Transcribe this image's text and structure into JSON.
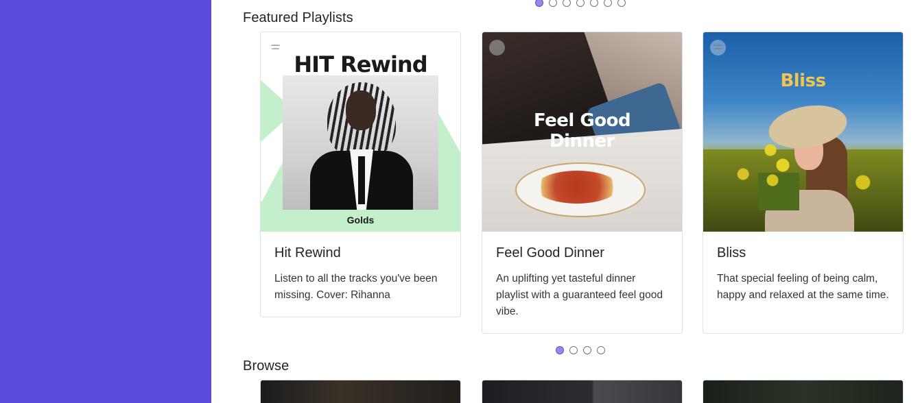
{
  "sidebar": {
    "color": "#5a4bdb"
  },
  "featured": {
    "title": "Featured Playlists",
    "carousel_dots_top": {
      "count": 7,
      "active_index": 0
    },
    "carousel_dots": {
      "count": 4,
      "active_index": 0
    },
    "cards": [
      {
        "art_title": "HIT Rewind",
        "art_subtitle": "Golds",
        "title": "Hit Rewind",
        "description": "Listen to all the tracks you've been missing. Cover: Rihanna"
      },
      {
        "art_title": "Feel Good\nDinner",
        "title": "Feel Good Dinner",
        "description": "An uplifting yet tasteful dinner playlist with a guaranteed feel good vibe."
      },
      {
        "art_title": "Bliss",
        "title": "Bliss",
        "description": "That special feeling of being calm, happy and relaxed at the same time."
      }
    ]
  },
  "browse": {
    "title": "Browse"
  },
  "colors": {
    "accent": "#5a4bdb",
    "dot_active": "#9b86e8",
    "spotify_icon": "spotify-icon"
  }
}
